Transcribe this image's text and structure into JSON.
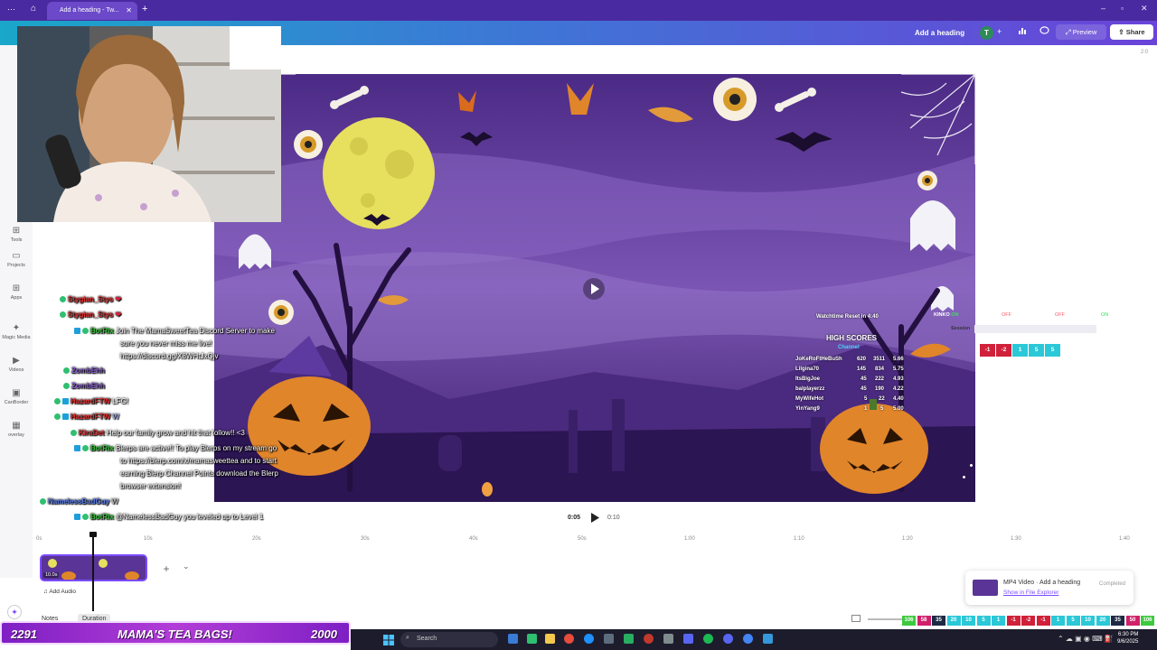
{
  "browser": {
    "tab_title": "Add a heading - Tw...",
    "new_tab": "+",
    "window_controls": [
      "–",
      "▫",
      "✕"
    ]
  },
  "header": {
    "doc_title": "Add a heading",
    "avatar_letter": "T",
    "preview_label": "Preview",
    "share_label": "Share",
    "zoom_indicator": "2:0"
  },
  "sidebar": {
    "items": [
      {
        "label": "Tools",
        "icon": "tools-icon"
      },
      {
        "label": "Projects",
        "icon": "folder-icon"
      },
      {
        "label": "Apps",
        "icon": "apps-icon"
      },
      {
        "label": "Magic Media",
        "icon": "magic-media-icon"
      },
      {
        "label": "Videos",
        "icon": "video-icon"
      },
      {
        "label": "CanBorder",
        "icon": "canborder-icon"
      },
      {
        "label": "overlay",
        "icon": "overlay-icon"
      }
    ]
  },
  "chat": [
    {
      "user": "Stygian_Stys",
      "user_color": "red",
      "message": "❤"
    },
    {
      "user": "Stygian_Stys",
      "user_color": "red",
      "message": "❤"
    },
    {
      "user": "BotRix",
      "user_color": "green",
      "message": "Join The MamaSweetTea Discord Server to make",
      "cont": [
        "sure you never miss me live!",
        "https://discord.gg/X8WHtJxQjv"
      ]
    },
    {
      "user": "ZombEhh",
      "user_color": "purple",
      "message": ""
    },
    {
      "user": "ZombEhh",
      "user_color": "purple",
      "message": ""
    },
    {
      "user": "HazardFTW",
      "user_color": "red",
      "message": "LFG!"
    },
    {
      "user": "HazardFTW",
      "user_color": "red",
      "message": "W"
    },
    {
      "user": "KiraDet",
      "user_color": "red",
      "message": "Help our family grow and hit that follow!! <3"
    },
    {
      "user": "BotRix",
      "user_color": "green",
      "message": "Blerps are active!! To play Blerps on my stream go",
      "cont": [
        "to https://blerp.com/x/mamasweettea and to start",
        "earning Blerp Channel Points download the Blerp",
        "browser extension!"
      ]
    },
    {
      "user": "NamelessBadGuy",
      "user_color": "blue",
      "message": "W"
    },
    {
      "user": "BotRix",
      "user_color": "green",
      "message": "@NamelessBadGuy you leveled up to Level 1"
    }
  ],
  "scoreboard": {
    "watchtime": "Watchtime Reset in 4:40",
    "title": "HIGH SCORES",
    "subtitle": "Channel",
    "rows": [
      [
        "JoKeRoFtHeBuSh",
        "620",
        "3511",
        "5.66"
      ],
      [
        "Lilgina70",
        "145",
        "834",
        "5.75"
      ],
      [
        "ItsBigJoe",
        "45",
        "222",
        "4.93"
      ],
      [
        "balplayerzz",
        "45",
        "190",
        "4.22"
      ],
      [
        "MyWifeHot",
        "5",
        "22",
        "4.40"
      ],
      [
        "YinYang9",
        "1",
        "5",
        "5.00"
      ]
    ],
    "kinko": "KINKO",
    "kinko_on": "ON",
    "session_label": "Session",
    "toggles": [
      "OFF",
      "OFF",
      "ON"
    ],
    "chips": [
      "-1",
      "-2",
      "1",
      "5",
      "5"
    ]
  },
  "player": {
    "current_time": "0:05",
    "total_time": "0:10"
  },
  "timeline": {
    "ticks": [
      "0s",
      "10s",
      "20s",
      "30s",
      "40s",
      "50s",
      "1:00",
      "1:10",
      "1:20",
      "1:30",
      "1:40"
    ],
    "clip_duration": "10.0s",
    "add_audio": "Add Audio",
    "notes": "Notes",
    "duration": "Duration"
  },
  "notification": {
    "title": "MP4 Video · Add a heading",
    "link": "Show in File Explorer",
    "status": "Completed"
  },
  "stream_bar": {
    "left_count": "2291",
    "center": "MAMA'S TEA BAGS!",
    "right_count": "2000"
  },
  "taskbar": {
    "search_placeholder": "Search",
    "time": "6:30 PM",
    "date": "9/6/2025"
  },
  "counters": {
    "values": [
      "106",
      "58",
      "35",
      "20",
      "10",
      "5",
      "1",
      "-1",
      "-2",
      "-1",
      "1",
      "5",
      "10",
      "20",
      "35",
      "50",
      "106"
    ]
  },
  "colors": {
    "brand_gradient_start": "#1aa7c9",
    "brand_gradient_end": "#6a43d8",
    "canvas_bg": "#5a3496",
    "moon": "#e7df5e",
    "pumpkin": "#e0852a"
  }
}
